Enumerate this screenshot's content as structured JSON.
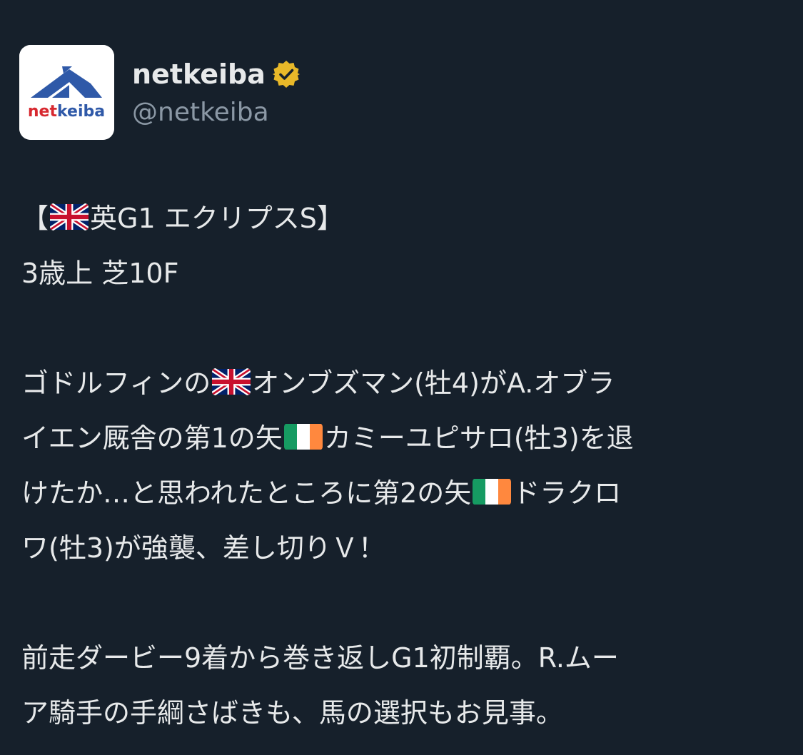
{
  "account": {
    "display_name": "netkeiba",
    "handle": "@netkeiba",
    "avatar_text": "netkeiba",
    "verified": true
  },
  "tweet": {
    "p1_l1_a": "【",
    "p1_l1_b": "英G1 エクリプスS】",
    "p1_l2": "3歳上 芝10F",
    "p2_l1_a": "ゴドルフィンの",
    "p2_l1_b": "オンブズマン(牡4)がA.オブラ",
    "p2_l2_a": "イエン厩舎の第1の矢",
    "p2_l2_b": "カミーユピサロ(牡3)を退",
    "p2_l3_a": "けたか…と思われたところに第2の矢",
    "p2_l3_b": "ドラクロ",
    "p2_l4": "ワ(牡3)が強襲、差し切りＶ！",
    "p3_l1": "前走ダービー9着から巻き返しG1初制覇。R.ムー",
    "p3_l2": "ア騎手の手綱さばきも、馬の選択もお見事。"
  },
  "flags": {
    "uk": "uk-flag-icon",
    "ireland": "ireland-flag-icon"
  },
  "colors": {
    "background": "#16202b",
    "text": "#e7e9ea",
    "secondary_text": "#8b98a5",
    "verified_gold": "#e8b829",
    "logo_blue": "#2f59a8",
    "logo_red": "#d7282f"
  }
}
